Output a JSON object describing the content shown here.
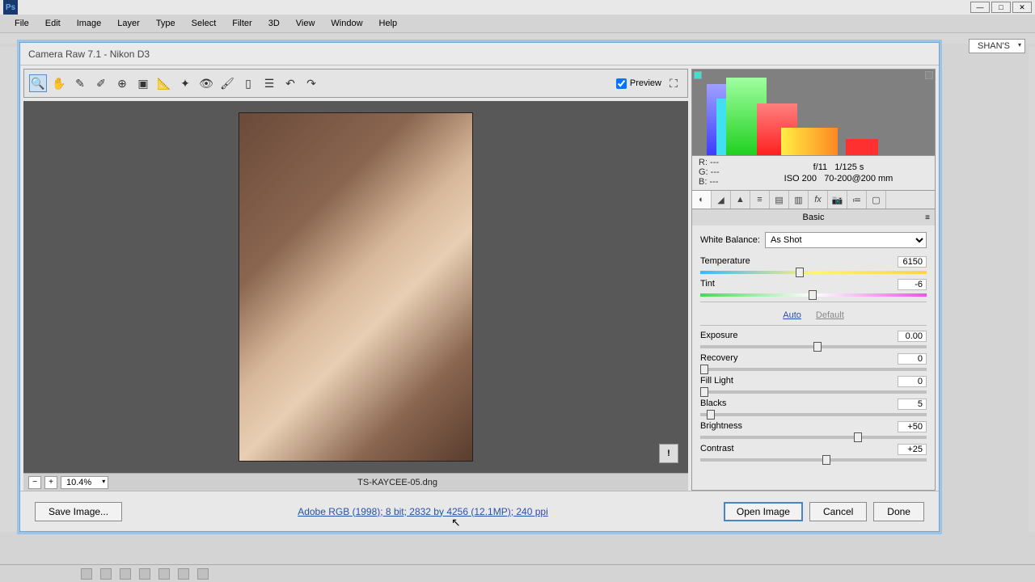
{
  "menus": [
    "File",
    "Edit",
    "Image",
    "Layer",
    "Type",
    "Select",
    "Filter",
    "3D",
    "View",
    "Window",
    "Help"
  ],
  "workspace": "SHAN'S",
  "cr": {
    "title": "Camera Raw 7.1  -  Nikon D3",
    "preview_label": "Preview",
    "filename": "TS-KAYCEE-05.dng",
    "zoom": "10.4%",
    "rgb": {
      "r": "R:   ---",
      "g": "G:   ---",
      "b": "B:   ---"
    },
    "shoot": {
      "line1a": "f/11",
      "line1b": "1/125 s",
      "line2a": "ISO 200",
      "line2b": "70-200@200 mm"
    },
    "panel_title": "Basic",
    "wb_label": "White Balance:",
    "wb_value": "As Shot",
    "sliders": {
      "temperature": {
        "label": "Temperature",
        "value": "6150",
        "pos": 42
      },
      "tint": {
        "label": "Tint",
        "value": "-6",
        "pos": 48
      },
      "exposure": {
        "label": "Exposure",
        "value": "0.00",
        "pos": 50
      },
      "recovery": {
        "label": "Recovery",
        "value": "0",
        "pos": 0
      },
      "filllight": {
        "label": "Fill Light",
        "value": "0",
        "pos": 0
      },
      "blacks": {
        "label": "Blacks",
        "value": "5",
        "pos": 3
      },
      "brightness": {
        "label": "Brightness",
        "value": "+50",
        "pos": 68
      },
      "contrast": {
        "label": "Contrast",
        "value": "+25",
        "pos": 54
      }
    },
    "auto_label": "Auto",
    "default_label": "Default",
    "footer": {
      "save": "Save Image...",
      "link": "Adobe RGB (1998); 8 bit; 2832 by 4256 (12.1MP); 240 ppi",
      "open": "Open Image",
      "cancel": "Cancel",
      "done": "Done"
    }
  }
}
